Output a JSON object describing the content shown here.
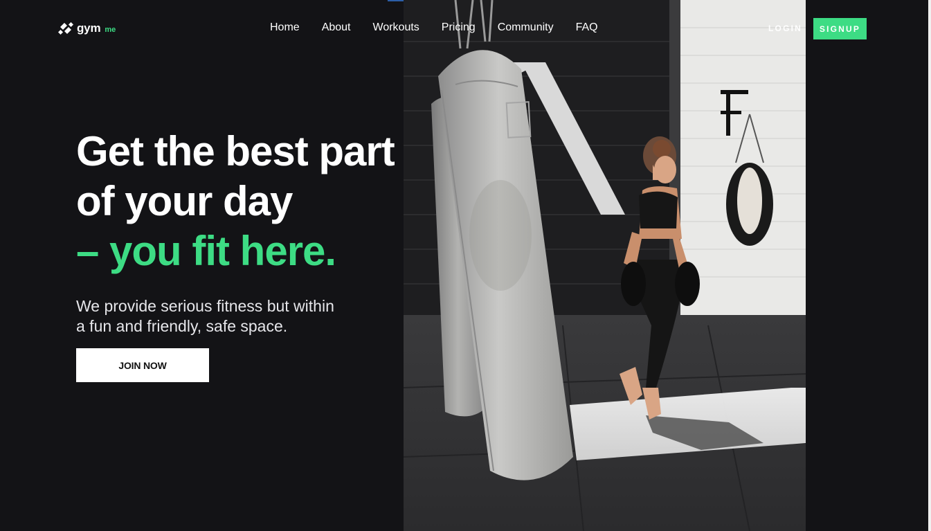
{
  "brand": {
    "name": "gym",
    "suffix": "me",
    "accent_color": "#3ddc84"
  },
  "nav": {
    "items": [
      {
        "label": "Home"
      },
      {
        "label": "About"
      },
      {
        "label": "Workouts"
      },
      {
        "label": "Pricing"
      },
      {
        "label": "Community"
      },
      {
        "label": "FAQ"
      }
    ]
  },
  "auth": {
    "login_label": "LOGIN",
    "signup_label": "SIGNUP"
  },
  "hero": {
    "headline_line1": "Get the best part",
    "headline_line2": "of your day",
    "headline_accent": "– you fit here.",
    "subtext_line1": "We provide serious fitness but within",
    "subtext_line2": "a fun and friendly, safe space.",
    "cta_label": "JOIN NOW",
    "image_icon": "boxing-gym-photo"
  },
  "colors": {
    "background": "#131316",
    "text": "#ffffff"
  }
}
